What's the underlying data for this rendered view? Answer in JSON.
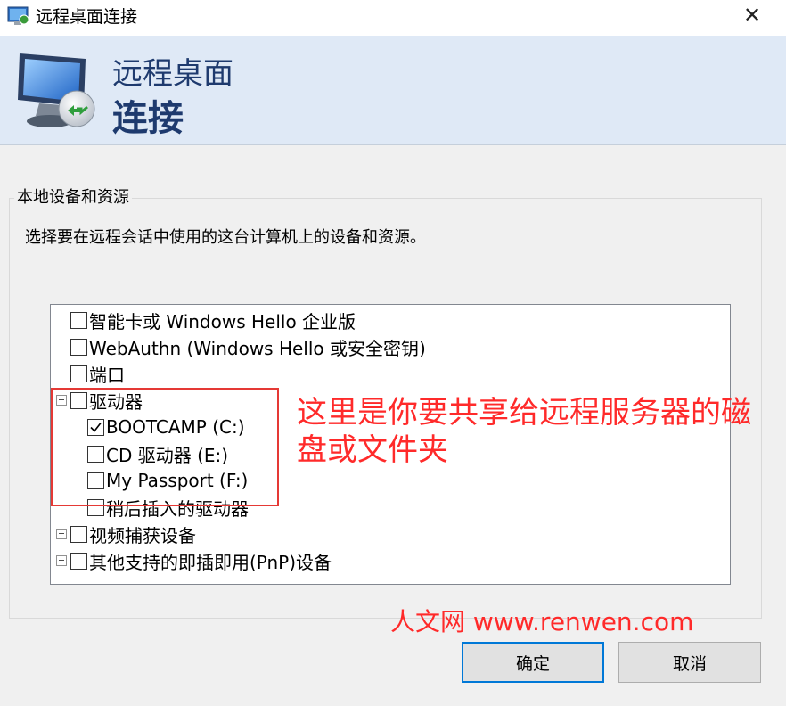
{
  "window": {
    "title": "远程桌面连接",
    "close_glyph": "✕"
  },
  "banner": {
    "line1": "远程桌面",
    "line2": "连接"
  },
  "group": {
    "label": "本地设备和资源",
    "description": "选择要在远程会话中使用的这台计算机上的设备和资源。"
  },
  "tree": {
    "items": [
      {
        "label": "智能卡或 Windows Hello 企业版",
        "checked": false
      },
      {
        "label": "WebAuthn (Windows Hello 或安全密钥)",
        "checked": false
      },
      {
        "label": "端口",
        "checked": false
      },
      {
        "label": "驱动器",
        "checked": false,
        "expanded": true
      },
      {
        "label": "BOOTCAMP (C:)",
        "checked": true
      },
      {
        "label": "CD 驱动器 (E:)",
        "checked": false
      },
      {
        "label": "My Passport (F:)",
        "checked": false
      },
      {
        "label": "稍后插入的驱动器",
        "checked": false
      },
      {
        "label": "视频捕获设备",
        "checked": false,
        "expanded": false
      },
      {
        "label": "其他支持的即插即用(PnP)设备",
        "checked": false,
        "expanded": false
      }
    ]
  },
  "annotation": {
    "text": "这里是你要共享给远程服务器的磁盘或文件夹",
    "watermark": "人文网 www.renwen.com",
    "color": "#ff2a2a"
  },
  "buttons": {
    "ok": "确定",
    "cancel": "取消"
  },
  "colors": {
    "banner_text": "#1e3a6e",
    "focus": "#0078d7"
  }
}
